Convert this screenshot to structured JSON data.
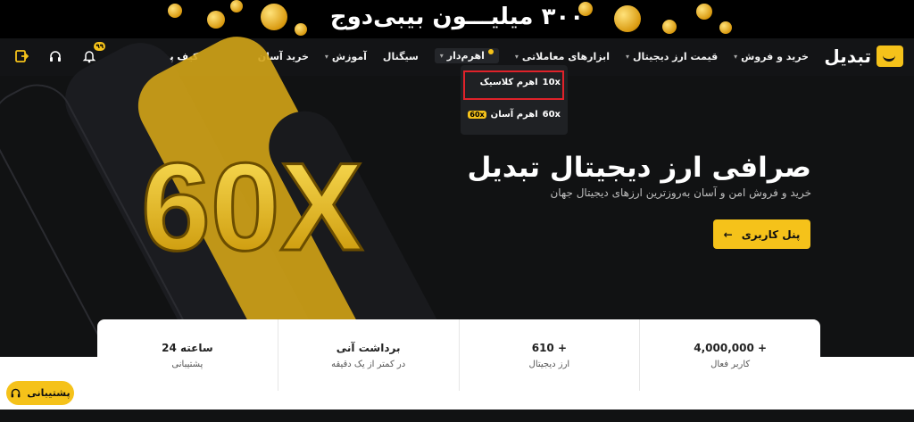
{
  "promo": {
    "text": "۳۰۰ میلیـــون بیبی‌دوج"
  },
  "brand": {
    "logo_text": "تبدیل",
    "accent": "#f5c21a"
  },
  "nav": {
    "items": [
      {
        "label": "خرید و فروش",
        "caret": true
      },
      {
        "label": "قیمت ارز دیجیتال",
        "caret": true
      },
      {
        "label": "ابزارهای معاملاتی",
        "caret": true
      },
      {
        "label": "اهرم‌دار",
        "caret": true
      },
      {
        "label": "سیگنال",
        "caret": false
      },
      {
        "label": "آموزش",
        "caret": true
      },
      {
        "label": "خرید آسان",
        "caret": false
      }
    ],
    "wallet_label": "کیف پول",
    "notification_count": "۹۹",
    "icons": [
      "user-icon",
      "bell-icon",
      "headset-icon",
      "login-icon"
    ]
  },
  "dropdown": {
    "items": [
      {
        "label": "اهرم کلاسیک",
        "tag": "10x",
        "chip": ""
      },
      {
        "label": "اهرم آسان",
        "tag": "60x",
        "chip": "60x"
      }
    ]
  },
  "hero": {
    "title": "صرافی ارز دیجیتال تبدیل",
    "subtitle": "خرید و فروش امن و آسان به‌روزترین ارزهای دیجیتال جهان",
    "cta": "پنل کاربری",
    "art_text": "60X"
  },
  "stats": [
    {
      "value": "4,000,000 +",
      "label": "کاربر فعال"
    },
    {
      "value": "610 +",
      "label": "ارز دیجیتال"
    },
    {
      "value": "برداشت آنی",
      "label": "در کمتر از یک دقیقه"
    },
    {
      "value": "24 ساعته",
      "label": "پشتیبانی"
    }
  ],
  "support_button": "پشتیبانی"
}
